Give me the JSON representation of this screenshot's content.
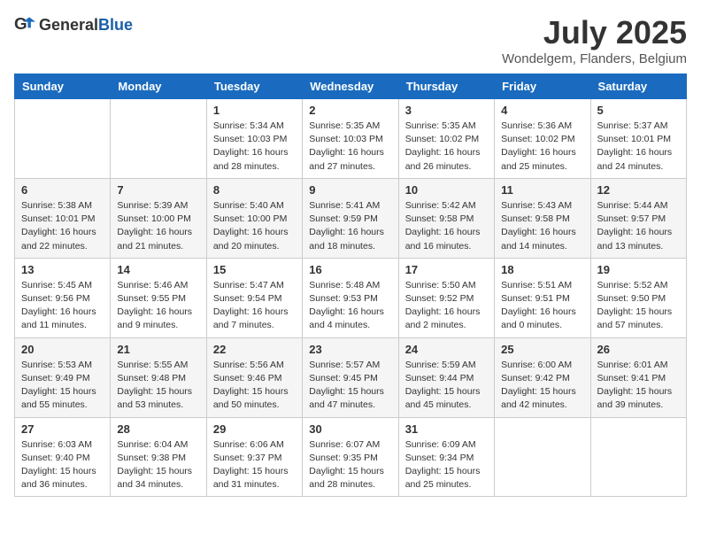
{
  "header": {
    "logo_general": "General",
    "logo_blue": "Blue",
    "month_title": "July 2025",
    "location": "Wondelgem, Flanders, Belgium"
  },
  "weekdays": [
    "Sunday",
    "Monday",
    "Tuesday",
    "Wednesday",
    "Thursday",
    "Friday",
    "Saturday"
  ],
  "weeks": [
    [
      {
        "day": "",
        "info": ""
      },
      {
        "day": "",
        "info": ""
      },
      {
        "day": "1",
        "info": "Sunrise: 5:34 AM\nSunset: 10:03 PM\nDaylight: 16 hours\nand 28 minutes."
      },
      {
        "day": "2",
        "info": "Sunrise: 5:35 AM\nSunset: 10:03 PM\nDaylight: 16 hours\nand 27 minutes."
      },
      {
        "day": "3",
        "info": "Sunrise: 5:35 AM\nSunset: 10:02 PM\nDaylight: 16 hours\nand 26 minutes."
      },
      {
        "day": "4",
        "info": "Sunrise: 5:36 AM\nSunset: 10:02 PM\nDaylight: 16 hours\nand 25 minutes."
      },
      {
        "day": "5",
        "info": "Sunrise: 5:37 AM\nSunset: 10:01 PM\nDaylight: 16 hours\nand 24 minutes."
      }
    ],
    [
      {
        "day": "6",
        "info": "Sunrise: 5:38 AM\nSunset: 10:01 PM\nDaylight: 16 hours\nand 22 minutes."
      },
      {
        "day": "7",
        "info": "Sunrise: 5:39 AM\nSunset: 10:00 PM\nDaylight: 16 hours\nand 21 minutes."
      },
      {
        "day": "8",
        "info": "Sunrise: 5:40 AM\nSunset: 10:00 PM\nDaylight: 16 hours\nand 20 minutes."
      },
      {
        "day": "9",
        "info": "Sunrise: 5:41 AM\nSunset: 9:59 PM\nDaylight: 16 hours\nand 18 minutes."
      },
      {
        "day": "10",
        "info": "Sunrise: 5:42 AM\nSunset: 9:58 PM\nDaylight: 16 hours\nand 16 minutes."
      },
      {
        "day": "11",
        "info": "Sunrise: 5:43 AM\nSunset: 9:58 PM\nDaylight: 16 hours\nand 14 minutes."
      },
      {
        "day": "12",
        "info": "Sunrise: 5:44 AM\nSunset: 9:57 PM\nDaylight: 16 hours\nand 13 minutes."
      }
    ],
    [
      {
        "day": "13",
        "info": "Sunrise: 5:45 AM\nSunset: 9:56 PM\nDaylight: 16 hours\nand 11 minutes."
      },
      {
        "day": "14",
        "info": "Sunrise: 5:46 AM\nSunset: 9:55 PM\nDaylight: 16 hours\nand 9 minutes."
      },
      {
        "day": "15",
        "info": "Sunrise: 5:47 AM\nSunset: 9:54 PM\nDaylight: 16 hours\nand 7 minutes."
      },
      {
        "day": "16",
        "info": "Sunrise: 5:48 AM\nSunset: 9:53 PM\nDaylight: 16 hours\nand 4 minutes."
      },
      {
        "day": "17",
        "info": "Sunrise: 5:50 AM\nSunset: 9:52 PM\nDaylight: 16 hours\nand 2 minutes."
      },
      {
        "day": "18",
        "info": "Sunrise: 5:51 AM\nSunset: 9:51 PM\nDaylight: 16 hours\nand 0 minutes."
      },
      {
        "day": "19",
        "info": "Sunrise: 5:52 AM\nSunset: 9:50 PM\nDaylight: 15 hours\nand 57 minutes."
      }
    ],
    [
      {
        "day": "20",
        "info": "Sunrise: 5:53 AM\nSunset: 9:49 PM\nDaylight: 15 hours\nand 55 minutes."
      },
      {
        "day": "21",
        "info": "Sunrise: 5:55 AM\nSunset: 9:48 PM\nDaylight: 15 hours\nand 53 minutes."
      },
      {
        "day": "22",
        "info": "Sunrise: 5:56 AM\nSunset: 9:46 PM\nDaylight: 15 hours\nand 50 minutes."
      },
      {
        "day": "23",
        "info": "Sunrise: 5:57 AM\nSunset: 9:45 PM\nDaylight: 15 hours\nand 47 minutes."
      },
      {
        "day": "24",
        "info": "Sunrise: 5:59 AM\nSunset: 9:44 PM\nDaylight: 15 hours\nand 45 minutes."
      },
      {
        "day": "25",
        "info": "Sunrise: 6:00 AM\nSunset: 9:42 PM\nDaylight: 15 hours\nand 42 minutes."
      },
      {
        "day": "26",
        "info": "Sunrise: 6:01 AM\nSunset: 9:41 PM\nDaylight: 15 hours\nand 39 minutes."
      }
    ],
    [
      {
        "day": "27",
        "info": "Sunrise: 6:03 AM\nSunset: 9:40 PM\nDaylight: 15 hours\nand 36 minutes."
      },
      {
        "day": "28",
        "info": "Sunrise: 6:04 AM\nSunset: 9:38 PM\nDaylight: 15 hours\nand 34 minutes."
      },
      {
        "day": "29",
        "info": "Sunrise: 6:06 AM\nSunset: 9:37 PM\nDaylight: 15 hours\nand 31 minutes."
      },
      {
        "day": "30",
        "info": "Sunrise: 6:07 AM\nSunset: 9:35 PM\nDaylight: 15 hours\nand 28 minutes."
      },
      {
        "day": "31",
        "info": "Sunrise: 6:09 AM\nSunset: 9:34 PM\nDaylight: 15 hours\nand 25 minutes."
      },
      {
        "day": "",
        "info": ""
      },
      {
        "day": "",
        "info": ""
      }
    ]
  ]
}
